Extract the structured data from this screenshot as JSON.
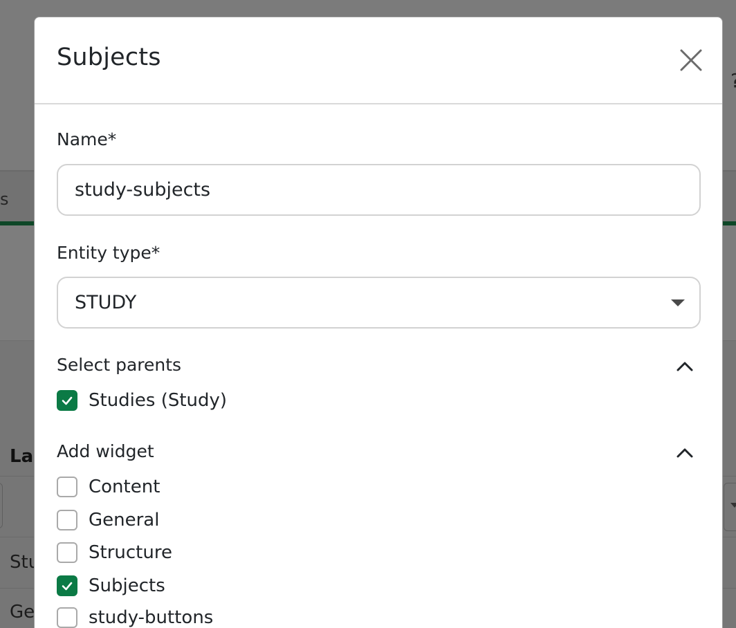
{
  "background": {
    "tab_fragment": "s",
    "column_header_fragment": "Lal",
    "row_fragments": [
      "Stu",
      "Ge"
    ],
    "top_right_glyph": "?"
  },
  "modal": {
    "title": "Subjects",
    "close_icon": "close-icon",
    "name_field": {
      "label": "Name*",
      "value": "study-subjects"
    },
    "entity_type_field": {
      "label": "Entity type*",
      "value": "STUDY",
      "caret_icon": "caret-down-icon"
    },
    "select_parents": {
      "title": "Select parents",
      "toggle_icon": "chevron-up-icon",
      "options": [
        {
          "label": "Studies (Study)",
          "checked": true
        }
      ]
    },
    "add_widget": {
      "title": "Add widget",
      "toggle_icon": "chevron-up-icon",
      "options": [
        {
          "label": "Content",
          "checked": false
        },
        {
          "label": "General",
          "checked": false
        },
        {
          "label": "Structure",
          "checked": false
        },
        {
          "label": "Subjects",
          "checked": true
        },
        {
          "label": "study-buttons",
          "checked": false
        }
      ]
    }
  },
  "colors": {
    "accent_green": "#0b7a45",
    "tab_underline": "#0e4727",
    "backdrop": "#7b7b7b"
  }
}
